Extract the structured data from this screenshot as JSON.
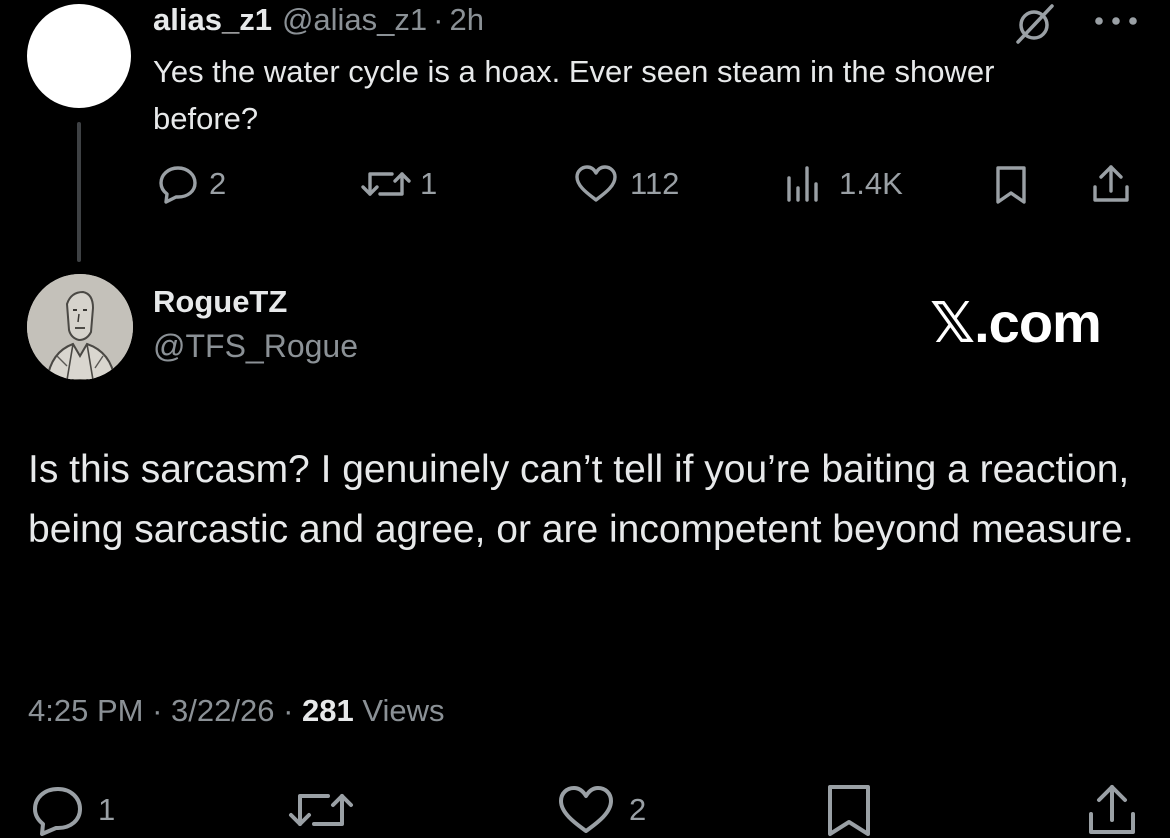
{
  "parent_tweet": {
    "display_name": "alias_z1",
    "handle": "@alias_z1",
    "separator": "·",
    "time": "2h",
    "text": "Yes the water cycle is a hoax. Ever seen steam in the shower before?",
    "actions": {
      "reply_count": "2",
      "repost_count": "1",
      "like_count": "112",
      "views_count": "1.4K"
    },
    "icons": [
      "grok-icon",
      "more-icon",
      "reply-icon",
      "repost-icon",
      "like-icon",
      "views-icon",
      "bookmark-icon",
      "share-icon"
    ]
  },
  "reply_tweet": {
    "display_name": "RogueTZ",
    "handle": "@TFS_Rogue",
    "text": "Is this sarcasm? I genuinely can’t tell if you’re baiting a reaction, being sarcastic and agree, or are incompetent beyond measure.",
    "time": "4:25 PM",
    "date": "3/22/26",
    "separator": "·",
    "views_count": "281",
    "views_label": "Views",
    "actions": {
      "reply_count": "1",
      "like_count": "2"
    }
  },
  "watermark": "𝕏.com",
  "colors": {
    "background": "#000000",
    "primary_text": "#e7e9ea",
    "secondary_text": "#8b9196",
    "icon": "#9aa0a5",
    "thread_line": "#3e4144"
  }
}
